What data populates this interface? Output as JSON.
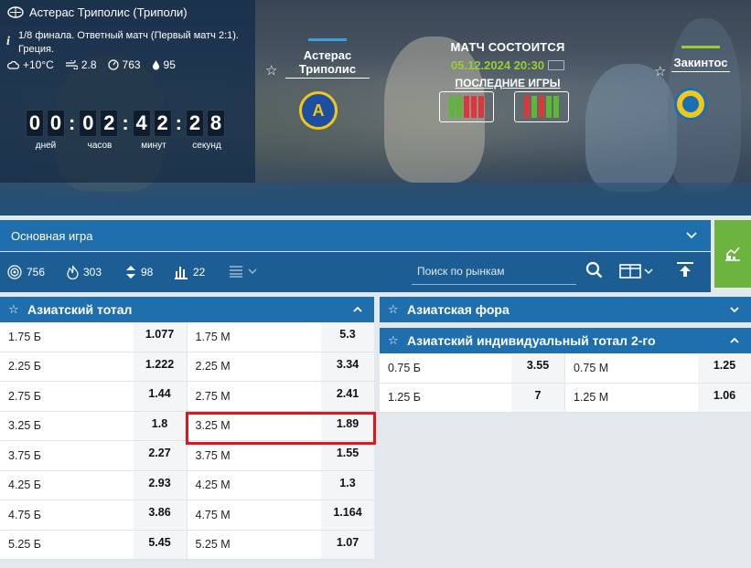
{
  "header": {
    "tournament": "Астерас Триполис (Триполи)",
    "stage": "1/8 финала. Ответный матч (Первый матч 2:1). Греция.",
    "weather": {
      "temperature": "+10°C",
      "wind": "2.8",
      "pressure": "763",
      "humidity": "95"
    },
    "timer": {
      "digits": [
        "0",
        "0",
        "0",
        "2",
        "4",
        "2",
        "2",
        "8"
      ],
      "labels": [
        "дней",
        "часов",
        "минут",
        "секунд"
      ]
    },
    "home_team": "Астерас Триполис",
    "home_crest_text": "А",
    "away_team": "Закинтос",
    "match_status": "МАТЧ СОСТОИТСЯ",
    "match_date": "05.12.2024 20:30",
    "last_games_label": "ПОСЛЕДНИЕ ИГРЫ",
    "home_form": [
      "win",
      "win",
      "loss",
      "loss",
      "loss"
    ],
    "away_form": [
      "loss",
      "win",
      "loss",
      "win",
      "win"
    ],
    "colors": {
      "win": "#5cb832",
      "loss": "#e0353a",
      "accent": "#1f6fae",
      "highlight": "#e3151a"
    }
  },
  "controls": {
    "main_select": "Основная игра",
    "stats": [
      {
        "icon": "target-icon",
        "value": "756"
      },
      {
        "icon": "flame-icon",
        "value": "303"
      },
      {
        "icon": "updown-arrows-icon",
        "value": "98"
      },
      {
        "icon": "bars-icon",
        "value": "22"
      }
    ],
    "search_placeholder": "Поиск по рынкам"
  },
  "markets": {
    "asian_total": {
      "title": "Азиатский тотал",
      "rows": [
        {
          "over": "1.75 Б",
          "over_odd": "1.077",
          "under": "1.75 М",
          "under_odd": "5.3"
        },
        {
          "over": "2.25 Б",
          "over_odd": "1.222",
          "under": "2.25 М",
          "under_odd": "3.34"
        },
        {
          "over": "2.75 Б",
          "over_odd": "1.44",
          "under": "2.75 М",
          "under_odd": "2.41"
        },
        {
          "over": "3.25 Б",
          "over_odd": "1.8",
          "under": "3.25 М",
          "under_odd": "1.89"
        },
        {
          "over": "3.75 Б",
          "over_odd": "2.27",
          "under": "3.75 М",
          "under_odd": "1.55"
        },
        {
          "over": "4.25 Б",
          "over_odd": "2.93",
          "under": "4.25 М",
          "under_odd": "1.3"
        },
        {
          "over": "4.75 Б",
          "over_odd": "3.86",
          "under": "4.75 М",
          "under_odd": "1.164"
        },
        {
          "over": "5.25 Б",
          "over_odd": "5.45",
          "under": "5.25 М",
          "under_odd": "1.07"
        }
      ]
    },
    "asian_handicap": {
      "title": "Азиатская фора"
    },
    "asian_individual_total_2": {
      "title": "Азиатский индивидуальный тотал 2-го",
      "rows": [
        {
          "over": "0.75 Б",
          "over_odd": "3.55",
          "under": "0.75 М",
          "under_odd": "1.25"
        },
        {
          "over": "1.25 Б",
          "over_odd": "7",
          "under": "1.25 М",
          "under_odd": "1.06"
        }
      ]
    }
  }
}
